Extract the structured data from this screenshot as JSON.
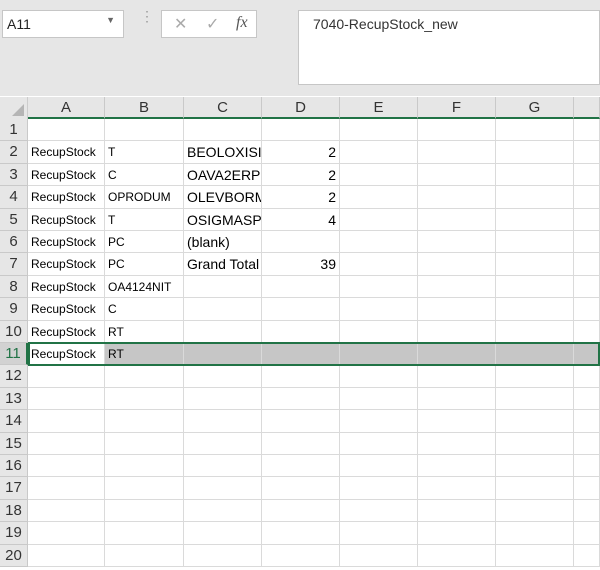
{
  "namebox": {
    "value": "A11"
  },
  "formula_bar": {
    "cancel_icon": "✕",
    "enter_icon": "✓",
    "fx_label": "fx",
    "value": "7040-RecupStock_new"
  },
  "columns": [
    "A",
    "B",
    "C",
    "D",
    "E",
    "F",
    "G"
  ],
  "rows": [
    "1",
    "2",
    "3",
    "4",
    "5",
    "6",
    "7",
    "8",
    "9",
    "10",
    "11",
    "12",
    "13",
    "14",
    "15",
    "16",
    "17",
    "18",
    "19",
    "20"
  ],
  "cells": [
    {
      "row": 2,
      "A": "RecupStock",
      "B": "T",
      "C": "BEOLOXISI",
      "D": "2"
    },
    {
      "row": 3,
      "A": "RecupStock",
      "B": "C",
      "C": "OAVA2ERP",
      "D": "2"
    },
    {
      "row": 4,
      "A": "RecupStock",
      "B": "OPRODUM",
      "C": "OLEVBORM",
      "D": "2"
    },
    {
      "row": 5,
      "A": "RecupStock",
      "B": "T",
      "C": "OSIGMASP",
      "D": "4"
    },
    {
      "row": 6,
      "A": "RecupStock",
      "B": "PC",
      "C": "(blank)",
      "D": ""
    },
    {
      "row": 7,
      "A": "RecupStock",
      "B": "PC",
      "C": "Grand Total",
      "D": "39"
    },
    {
      "row": 8,
      "A": "RecupStock",
      "B": "OA4124NIT",
      "C": "",
      "D": ""
    },
    {
      "row": 9,
      "A": "RecupStock",
      "B": "C",
      "C": "",
      "D": ""
    },
    {
      "row": 10,
      "A": "RecupStock",
      "B": "RT",
      "C": "",
      "D": ""
    },
    {
      "row": 11,
      "A": "RecupStock",
      "B": "RT",
      "C": "",
      "D": ""
    }
  ],
  "selected_row": 11
}
